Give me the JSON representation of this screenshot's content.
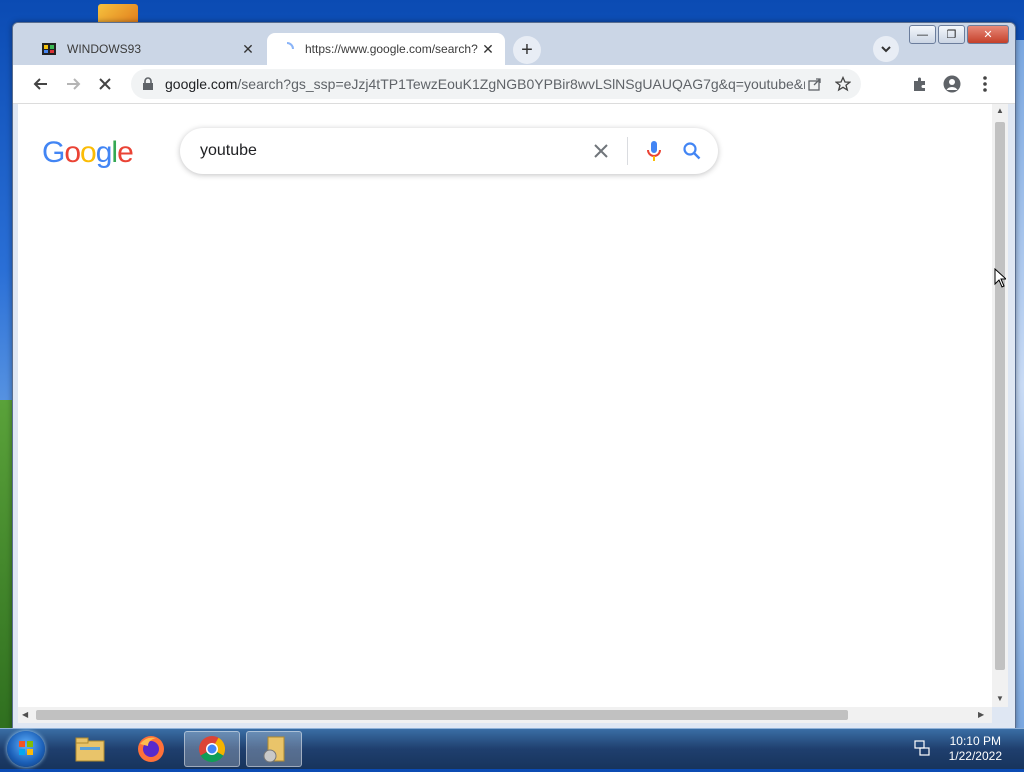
{
  "browser": {
    "tabs": [
      {
        "title": "WINDOWS93",
        "active": false
      },
      {
        "title": "https://www.google.com/search?",
        "active": true,
        "loading": true
      }
    ],
    "url_domain": "google.com",
    "url_path": "/search?gs_ssp=eJzj4tTP1TewzEouK1ZgNGB0YPBir8wvLSlNSgUAUQAG7g&q=youtube&rlz=1C..."
  },
  "page": {
    "logo_text": "Google",
    "search_query": "youtube"
  },
  "taskbar": {
    "time": "10:10 PM",
    "date": "1/22/2022"
  },
  "colors": {
    "google_blue": "#4285F4",
    "google_red": "#EA4335",
    "google_yellow": "#FBBC05",
    "google_green": "#34A853"
  }
}
